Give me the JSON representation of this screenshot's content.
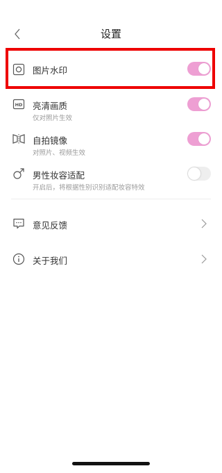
{
  "header": {
    "title": "设置"
  },
  "settings": [
    {
      "label": "图片水印",
      "sub": "",
      "toggle_on": true,
      "icon": "square-circle-icon"
    },
    {
      "label": "亮清画质",
      "sub": "仅对照片生效",
      "toggle_on": true,
      "icon": "hd-icon"
    },
    {
      "label": "自拍镜像",
      "sub": "对照片、视频生效",
      "toggle_on": true,
      "icon": "mirror-icon"
    },
    {
      "label": "男性妆容适配",
      "sub": "开启后，将根据性别识别适配妆容特效",
      "toggle_on": false,
      "icon": "male-icon"
    }
  ],
  "links": [
    {
      "label": "意见反馈",
      "icon": "feedback-icon"
    },
    {
      "label": "关于我们",
      "icon": "info-icon"
    }
  ],
  "colors": {
    "toggle_on": "#ee9fd3",
    "toggle_off": "#eeeeee",
    "highlight": "#ee0000"
  }
}
